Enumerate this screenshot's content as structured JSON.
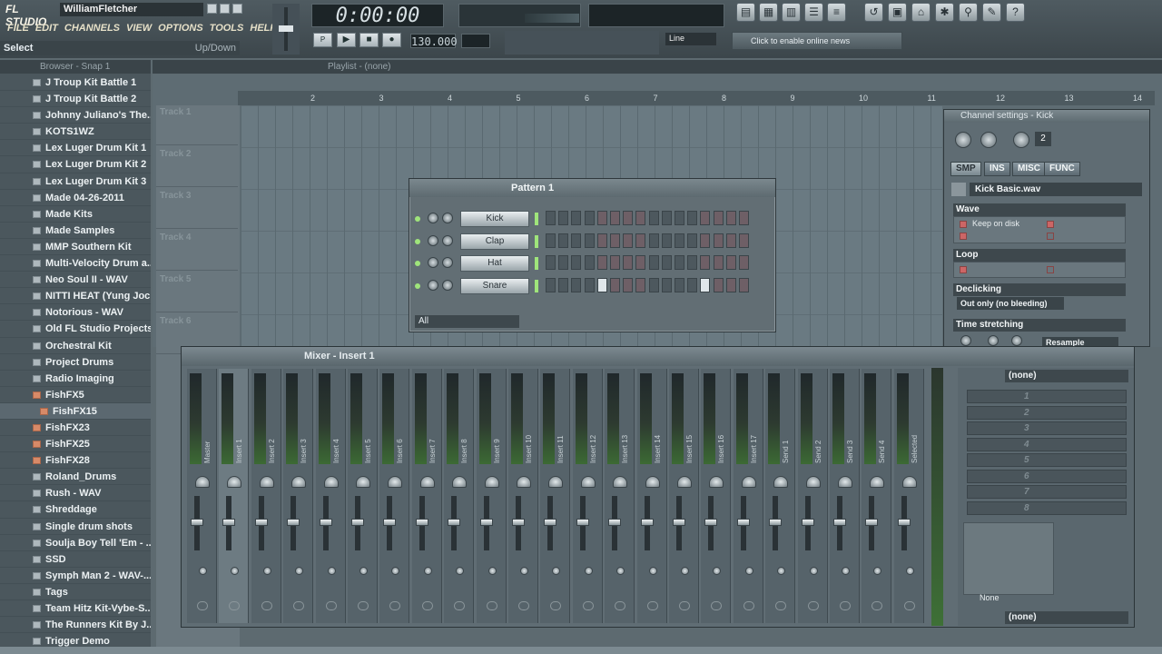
{
  "app": {
    "logo": "FL STUDIO",
    "user": "WilliamFletcher"
  },
  "menu": [
    "FILE",
    "EDIT",
    "CHANNELS",
    "VIEW",
    "OPTIONS",
    "TOOLS",
    "HELP"
  ],
  "hint": {
    "left": "Select",
    "right": "Up/Down"
  },
  "transport": {
    "time": "0:00:00",
    "tempo": "130.000",
    "snap": "Line",
    "news": "Click to enable online news"
  },
  "browser": {
    "title": "Browser - Snap 1",
    "items": [
      {
        "label": "J Troup Kit Battle 1",
        "open": false,
        "sub": false
      },
      {
        "label": "J Troup Kit Battle 2",
        "open": false,
        "sub": false
      },
      {
        "label": "Johnny Juliano's The...",
        "open": false,
        "sub": false
      },
      {
        "label": "KOTS1WZ",
        "open": false,
        "sub": false
      },
      {
        "label": "Lex Luger Drum Kit 1",
        "open": false,
        "sub": false
      },
      {
        "label": "Lex Luger Drum Kit 2",
        "open": false,
        "sub": false
      },
      {
        "label": "Lex Luger Drum Kit 3",
        "open": false,
        "sub": false
      },
      {
        "label": "Made 04-26-2011",
        "open": false,
        "sub": false
      },
      {
        "label": "Made Kits",
        "open": false,
        "sub": false
      },
      {
        "label": "Made Samples",
        "open": false,
        "sub": false
      },
      {
        "label": "MMP Southern Kit",
        "open": false,
        "sub": false
      },
      {
        "label": "Multi-Velocity Drum a...",
        "open": false,
        "sub": false
      },
      {
        "label": "Neo Soul II - WAV",
        "open": false,
        "sub": false
      },
      {
        "label": "NITTI HEAT (Yung Joc...",
        "open": false,
        "sub": false
      },
      {
        "label": "Notorious - WAV",
        "open": false,
        "sub": false
      },
      {
        "label": "Old FL Studio Projects",
        "open": false,
        "sub": false
      },
      {
        "label": "Orchestral Kit",
        "open": false,
        "sub": false
      },
      {
        "label": "Project Drums",
        "open": false,
        "sub": false
      },
      {
        "label": "Radio Imaging",
        "open": false,
        "sub": false
      },
      {
        "label": "FishFX5",
        "open": true,
        "sub": false
      },
      {
        "label": "FishFX15",
        "open": true,
        "sub": true
      },
      {
        "label": "FishFX23",
        "open": true,
        "sub": false
      },
      {
        "label": "FishFX25",
        "open": true,
        "sub": false
      },
      {
        "label": "FishFX28",
        "open": true,
        "sub": false
      },
      {
        "label": "Roland_Drums",
        "open": false,
        "sub": false
      },
      {
        "label": "Rush - WAV",
        "open": false,
        "sub": false
      },
      {
        "label": "Shreddage",
        "open": false,
        "sub": false
      },
      {
        "label": "Single drum shots",
        "open": false,
        "sub": false
      },
      {
        "label": "Soulja Boy Tell 'Em - ...",
        "open": false,
        "sub": false
      },
      {
        "label": "SSD",
        "open": false,
        "sub": false
      },
      {
        "label": "Symph Man 2 - WAV-...",
        "open": false,
        "sub": false
      },
      {
        "label": "Tags",
        "open": false,
        "sub": false
      },
      {
        "label": "Team Hitz Kit-Vybe-S...",
        "open": false,
        "sub": false
      },
      {
        "label": "The Runners Kit By J...",
        "open": false,
        "sub": false
      },
      {
        "label": "Trigger Demo",
        "open": false,
        "sub": false
      }
    ]
  },
  "playlist": {
    "title": "Playlist - (none)",
    "ruler": [
      "2",
      "3",
      "4",
      "5",
      "6",
      "7",
      "8",
      "9",
      "10",
      "11",
      "12",
      "13",
      "14"
    ],
    "tracks": [
      "Track 1",
      "Track 2",
      "Track 3",
      "Track 4",
      "Track 5",
      "Track 6"
    ]
  },
  "pattern": {
    "title": "Pattern 1",
    "filter": "All",
    "channels": [
      {
        "name": "Kick",
        "steps": [
          0,
          0,
          0,
          0,
          0,
          0,
          0,
          0,
          0,
          0,
          0,
          0,
          0,
          0,
          0,
          0
        ]
      },
      {
        "name": "Clap",
        "steps": [
          0,
          0,
          0,
          0,
          0,
          0,
          0,
          0,
          0,
          0,
          0,
          0,
          0,
          0,
          0,
          0
        ]
      },
      {
        "name": "Hat",
        "steps": [
          0,
          0,
          0,
          0,
          0,
          0,
          0,
          0,
          0,
          0,
          0,
          0,
          0,
          0,
          0,
          0
        ]
      },
      {
        "name": "Snare",
        "steps": [
          0,
          0,
          0,
          0,
          1,
          0,
          0,
          0,
          0,
          0,
          0,
          0,
          1,
          0,
          0,
          0
        ]
      }
    ]
  },
  "channel_settings": {
    "title": "Channel settings - Kick",
    "target": "2",
    "tabs": [
      "SMP",
      "INS",
      "MISC",
      "FUNC"
    ],
    "sample": "Kick Basic.wav",
    "wave": {
      "label": "Wave",
      "keep": "Keep on disk"
    },
    "loop": {
      "label": "Loop"
    },
    "declicking": {
      "label": "Declicking",
      "value": "Out only (no bleeding)"
    },
    "stretch": {
      "label": "Time stretching",
      "value": "Resample"
    }
  },
  "mixer": {
    "title": "Mixer - Insert 1",
    "strips": [
      "Master",
      "Insert 1",
      "Insert 2",
      "Insert 3",
      "Insert 4",
      "Insert 5",
      "Insert 6",
      "Insert 7",
      "Insert 8",
      "Insert 9",
      "Insert 10",
      "Insert 11",
      "Insert 12",
      "Insert 13",
      "Insert 14",
      "Insert 15",
      "Insert 16",
      "Insert 17",
      "Send 1",
      "Send 2",
      "Send 3",
      "Send 4",
      "Selected"
    ],
    "in": "(none)",
    "out": "(none)",
    "eq": "None",
    "slots": [
      "1",
      "2",
      "3",
      "4",
      "5",
      "6",
      "7",
      "8"
    ]
  }
}
